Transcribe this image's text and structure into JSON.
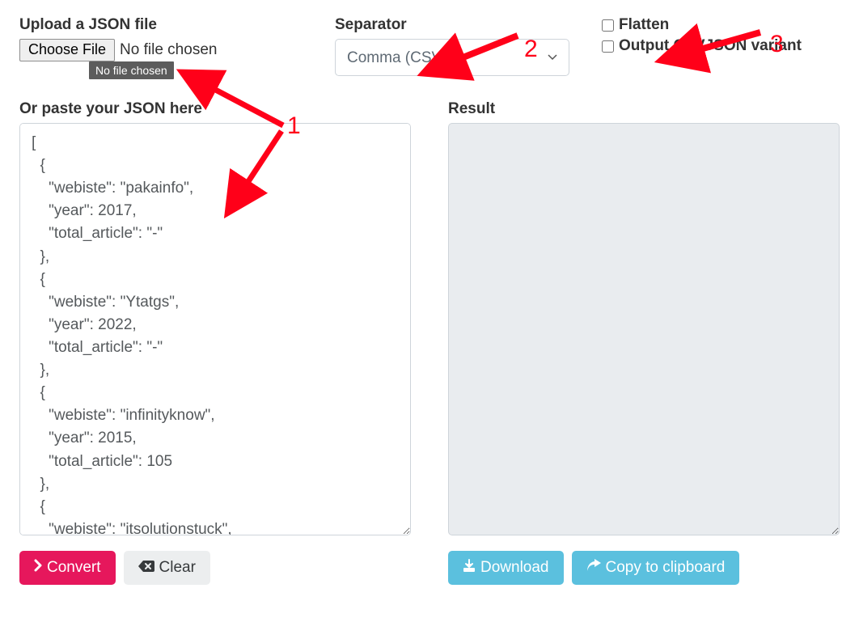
{
  "upload": {
    "label": "Upload a JSON file",
    "button": "Choose File",
    "status": "No file chosen",
    "tooltip": "No file chosen"
  },
  "separator": {
    "label": "Separator",
    "selected": "Comma (CSV)"
  },
  "options": {
    "flatten_label": "Flatten",
    "csvjson_label": "Output CSVJSON variant"
  },
  "paste": {
    "label": "Or paste your JSON here",
    "content": "[\n  {\n    \"webiste\": \"pakainfo\",\n    \"year\": 2017,\n    \"total_article\": \"-\"\n  },\n  {\n    \"webiste\": \"Ytatgs\",\n    \"year\": 2022,\n    \"total_article\": \"-\"\n  },\n  {\n    \"webiste\": \"infinityknow\",\n    \"year\": 2015,\n    \"total_article\": 105\n  },\n  {\n    \"webiste\": \"itsolutionstuck\","
  },
  "result": {
    "label": "Result",
    "content": ""
  },
  "buttons": {
    "convert": "Convert",
    "clear": "Clear",
    "download": "Download",
    "copy": "Copy to clipboard"
  },
  "annotations": {
    "n1": "1",
    "n2": "2",
    "n3": "3"
  }
}
